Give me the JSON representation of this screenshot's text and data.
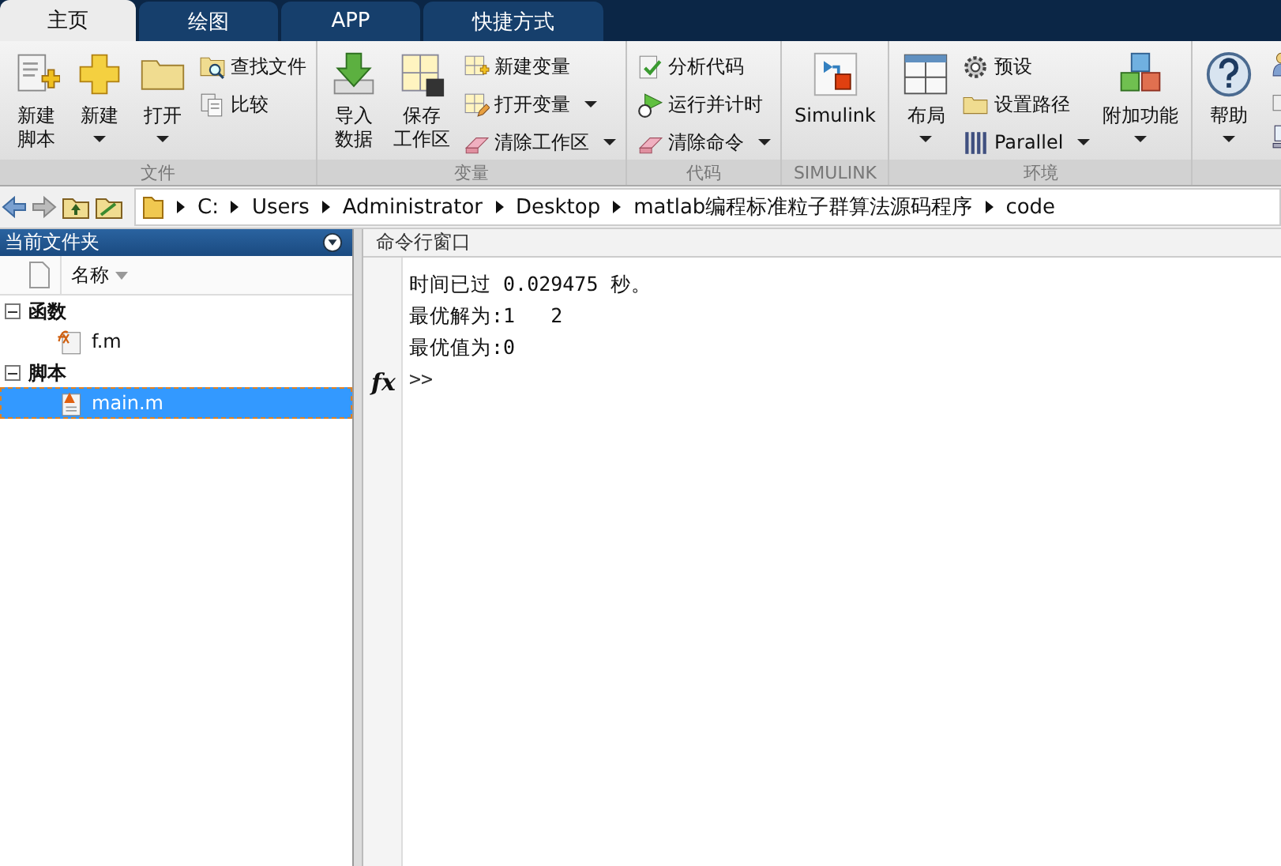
{
  "tabs": [
    {
      "label": "主页",
      "selected": true
    },
    {
      "label": "绘图",
      "selected": false
    },
    {
      "label": "APP",
      "selected": false
    },
    {
      "label": "快捷方式",
      "selected": false
    }
  ],
  "ribbon": {
    "groups": [
      {
        "label": "文件",
        "columns": [
          {
            "kind": "large",
            "lines": [
              "新建",
              "脚本"
            ],
            "dropdown": false
          },
          {
            "kind": "large",
            "lines": [
              "新建"
            ],
            "dropdown": true
          },
          {
            "kind": "large",
            "lines": [
              "打开"
            ],
            "dropdown": true
          },
          {
            "kind": "stack",
            "items": [
              {
                "label": "查找文件",
                "dropdown": false
              },
              {
                "label": "比较",
                "dropdown": false
              }
            ]
          }
        ]
      },
      {
        "label": "变量",
        "columns": [
          {
            "kind": "large",
            "lines": [
              "导入",
              "数据"
            ],
            "dropdown": false
          },
          {
            "kind": "large",
            "lines": [
              "保存",
              "工作区"
            ],
            "dropdown": false
          },
          {
            "kind": "stack",
            "items": [
              {
                "label": "新建变量",
                "dropdown": false
              },
              {
                "label": "打开变量",
                "dropdown": true
              },
              {
                "label": "清除工作区",
                "dropdown": true
              }
            ]
          }
        ]
      },
      {
        "label": "代码",
        "columns": [
          {
            "kind": "stack",
            "items": [
              {
                "label": "分析代码",
                "dropdown": false
              },
              {
                "label": "运行并计时",
                "dropdown": false
              },
              {
                "label": "清除命令",
                "dropdown": true
              }
            ]
          }
        ]
      },
      {
        "label": "SIMULINK",
        "columns": [
          {
            "kind": "large",
            "lines": [
              "Simulink"
            ],
            "dropdown": false
          }
        ]
      },
      {
        "label": "环境",
        "columns": [
          {
            "kind": "large",
            "lines": [
              "布局"
            ],
            "dropdown": true
          },
          {
            "kind": "stack",
            "items": [
              {
                "label": "预设",
                "dropdown": false
              },
              {
                "label": "设置路径",
                "dropdown": false
              },
              {
                "label": "Parallel",
                "dropdown": true
              }
            ]
          },
          {
            "kind": "large",
            "lines": [
              "附加功能"
            ],
            "dropdown": true
          }
        ]
      },
      {
        "columns": [
          {
            "kind": "large",
            "lines": [
              "帮助"
            ],
            "dropdown": true
          }
        ]
      }
    ]
  },
  "address_bar": {
    "path": [
      "C:",
      "Users",
      "Administrator",
      "Desktop",
      "matlab编程标准粒子群算法源码程序",
      "code"
    ]
  },
  "file_browser": {
    "title": "当前文件夹",
    "column": "名称",
    "groups": [
      {
        "label": "函数",
        "expanded": true,
        "files": [
          {
            "name": "f.m",
            "kind": "function",
            "selected": false
          }
        ]
      },
      {
        "label": "脚本",
        "expanded": true,
        "files": [
          {
            "name": "main.m",
            "kind": "script",
            "selected": true
          }
        ]
      }
    ]
  },
  "command_window": {
    "title": "命令行窗口",
    "lines": [
      "时间已过 0.029475 秒。",
      "最优解为:1   2",
      "最优值为:0"
    ],
    "prompt": ">>",
    "gutter_icon": "fx"
  }
}
